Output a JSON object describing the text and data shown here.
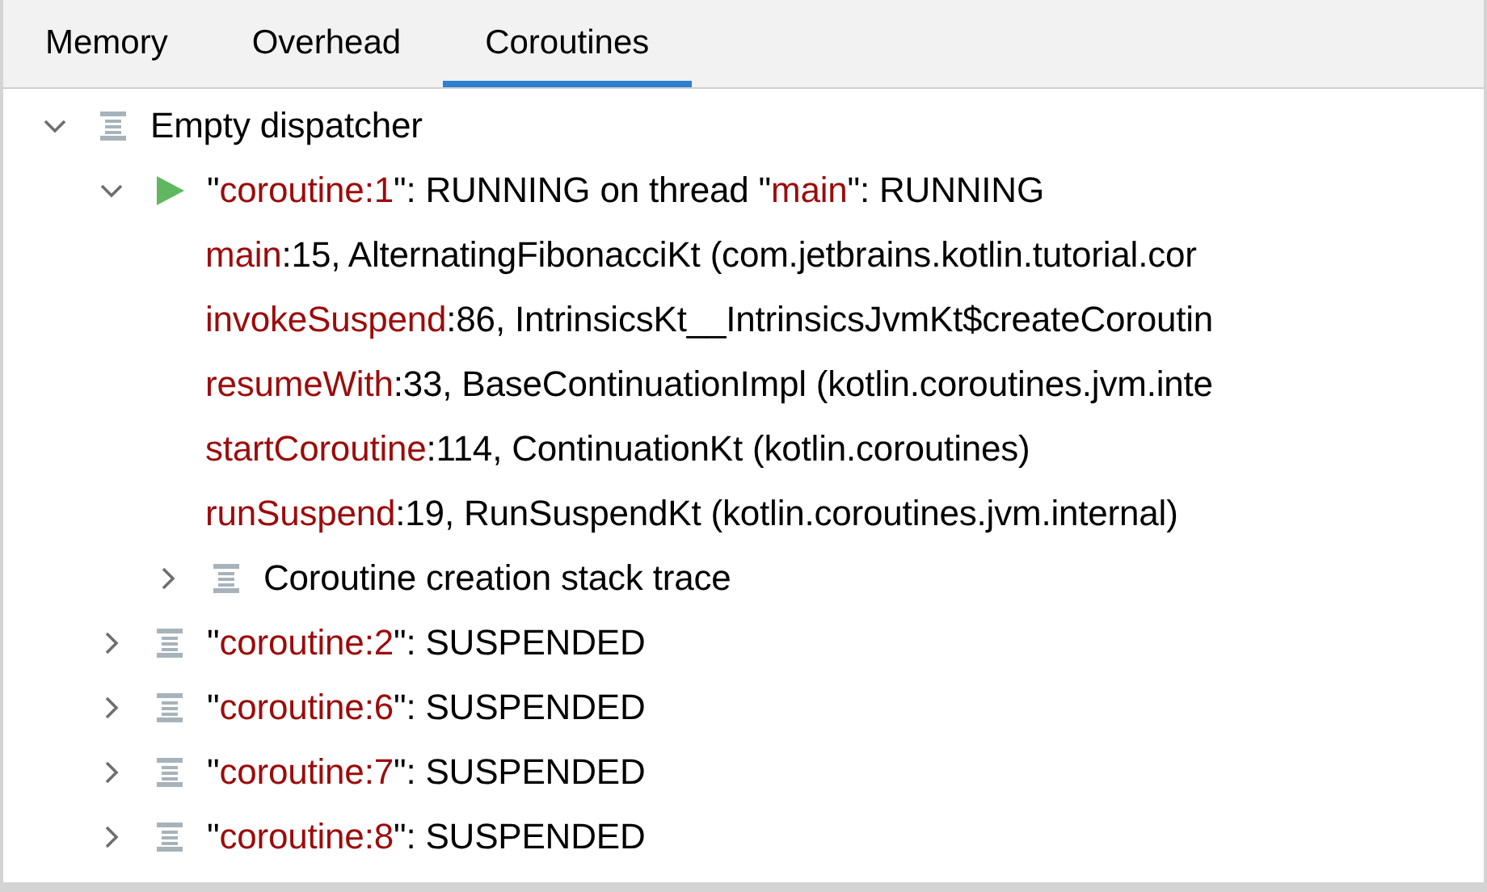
{
  "tabs": [
    {
      "label": "Memory",
      "selected": false
    },
    {
      "label": "Overhead",
      "selected": false
    },
    {
      "label": "Coroutines",
      "selected": true
    }
  ],
  "tree": [
    {
      "kind": "dispatcher",
      "expanded": true,
      "parts": [
        {
          "text": "Empty dispatcher",
          "highlight": false
        }
      ],
      "children": [
        {
          "kind": "running",
          "expanded": true,
          "parts": [
            {
              "text": "\"",
              "highlight": false
            },
            {
              "text": "coroutine:1",
              "highlight": true
            },
            {
              "text": "\": RUNNING on thread \"",
              "highlight": false
            },
            {
              "text": "main",
              "highlight": true
            },
            {
              "text": "\": RUNNING",
              "highlight": false
            }
          ],
          "children": [
            {
              "kind": "frame",
              "parts": [
                {
                  "text": "main",
                  "highlight": true
                },
                {
                  "text": ":15, AlternatingFibonacciKt (com.jetbrains.kotlin.tutorial.cor",
                  "highlight": false
                }
              ]
            },
            {
              "kind": "frame",
              "parts": [
                {
                  "text": "invokeSuspend",
                  "highlight": true
                },
                {
                  "text": ":86, IntrinsicsKt__IntrinsicsJvmKt$createCoroutin",
                  "highlight": false
                }
              ]
            },
            {
              "kind": "frame",
              "parts": [
                {
                  "text": "resumeWith",
                  "highlight": true
                },
                {
                  "text": ":33, BaseContinuationImpl (kotlin.coroutines.jvm.inte",
                  "highlight": false
                }
              ]
            },
            {
              "kind": "frame",
              "parts": [
                {
                  "text": "startCoroutine",
                  "highlight": true
                },
                {
                  "text": ":114, ContinuationKt (kotlin.coroutines)",
                  "highlight": false
                }
              ]
            },
            {
              "kind": "frame",
              "parts": [
                {
                  "text": "runSuspend",
                  "highlight": true
                },
                {
                  "text": ":19, RunSuspendKt (kotlin.coroutines.jvm.internal)",
                  "highlight": false
                }
              ]
            },
            {
              "kind": "stacktrace",
              "expanded": false,
              "parts": [
                {
                  "text": "Coroutine creation stack trace",
                  "highlight": false
                }
              ]
            }
          ]
        },
        {
          "kind": "suspended",
          "expanded": false,
          "parts": [
            {
              "text": "\"",
              "highlight": false
            },
            {
              "text": "coroutine:2",
              "highlight": true
            },
            {
              "text": "\": SUSPENDED",
              "highlight": false
            }
          ]
        },
        {
          "kind": "suspended",
          "expanded": false,
          "parts": [
            {
              "text": "\"",
              "highlight": false
            },
            {
              "text": "coroutine:6",
              "highlight": true
            },
            {
              "text": "\": SUSPENDED",
              "highlight": false
            }
          ]
        },
        {
          "kind": "suspended",
          "expanded": false,
          "parts": [
            {
              "text": "\"",
              "highlight": false
            },
            {
              "text": "coroutine:7",
              "highlight": true
            },
            {
              "text": "\": SUSPENDED",
              "highlight": false
            }
          ]
        },
        {
          "kind": "suspended",
          "expanded": false,
          "parts": [
            {
              "text": "\"",
              "highlight": false
            },
            {
              "text": "coroutine:8",
              "highlight": true
            },
            {
              "text": "\": SUSPENDED",
              "highlight": false
            }
          ]
        }
      ]
    }
  ]
}
